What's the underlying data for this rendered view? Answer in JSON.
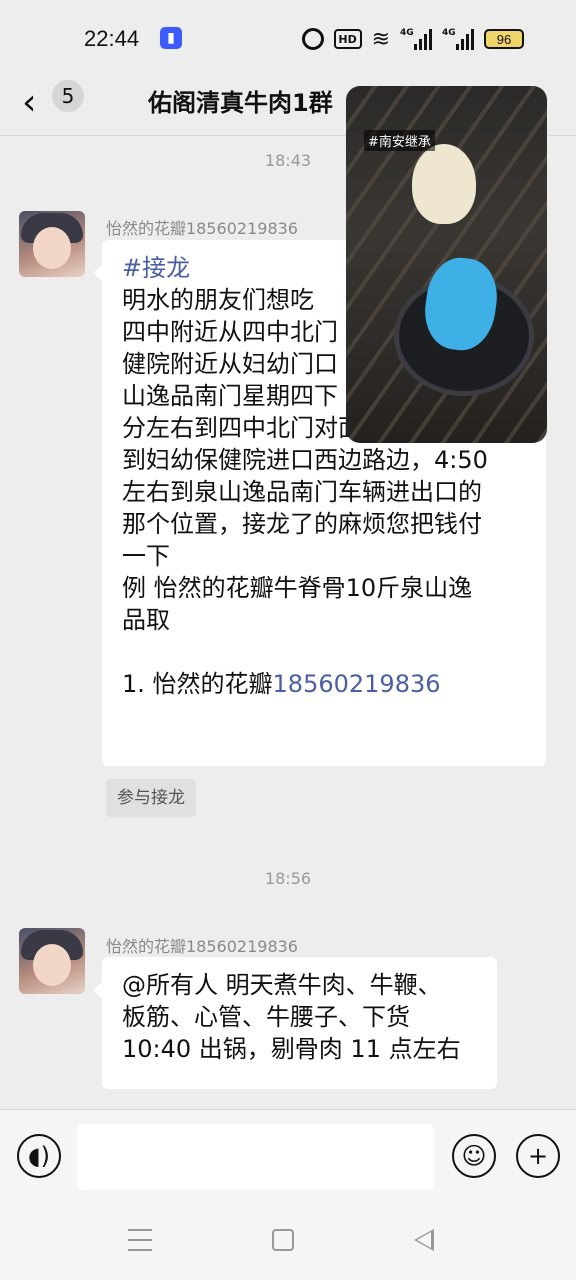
{
  "status_bar": {
    "time": "22:44",
    "hd_label": "HD",
    "signal_label_1": "4G",
    "signal_label_2": "4G",
    "battery": "96"
  },
  "header": {
    "unread_count": "5",
    "title": "佑阁清真牛肉1群"
  },
  "messages": [
    {
      "timestamp": "18:43",
      "sender": "怡然的花瓣18560219836",
      "tag": "#接龙",
      "lines": [
        "明水的朋友们想吃",
        "四中附近从四中北门",
        "健院附近从妇幼门口",
        "山逸品南门星期四下",
        "分左右到四中北门对面，4:30左右",
        "到妇幼保健院进口西边路边，4:50",
        "左右到泉山逸品南门车辆进出口的",
        "那个位置，接龙了的麻烦您把钱付",
        "一下",
        "例 怡然的花瓣牛脊骨10斤泉山逸",
        "品取",
        ""
      ],
      "entry_name": "1. 怡然的花瓣",
      "entry_phone": "18560219836",
      "join_button": "参与接龙"
    },
    {
      "timestamp": "18:56",
      "sender": "怡然的花瓣18560219836",
      "lines": [
        "@所有人  明天煮牛肉、牛鞭、",
        "板筋、心管、牛腰子、下货",
        "10:40 出锅，剔骨肉 11 点左右"
      ]
    }
  ],
  "floating_video": {
    "label": "#南安继承"
  },
  "icons": {
    "voice": "voice-icon",
    "emoji": "emoji-icon",
    "plus": "plus-icon"
  }
}
